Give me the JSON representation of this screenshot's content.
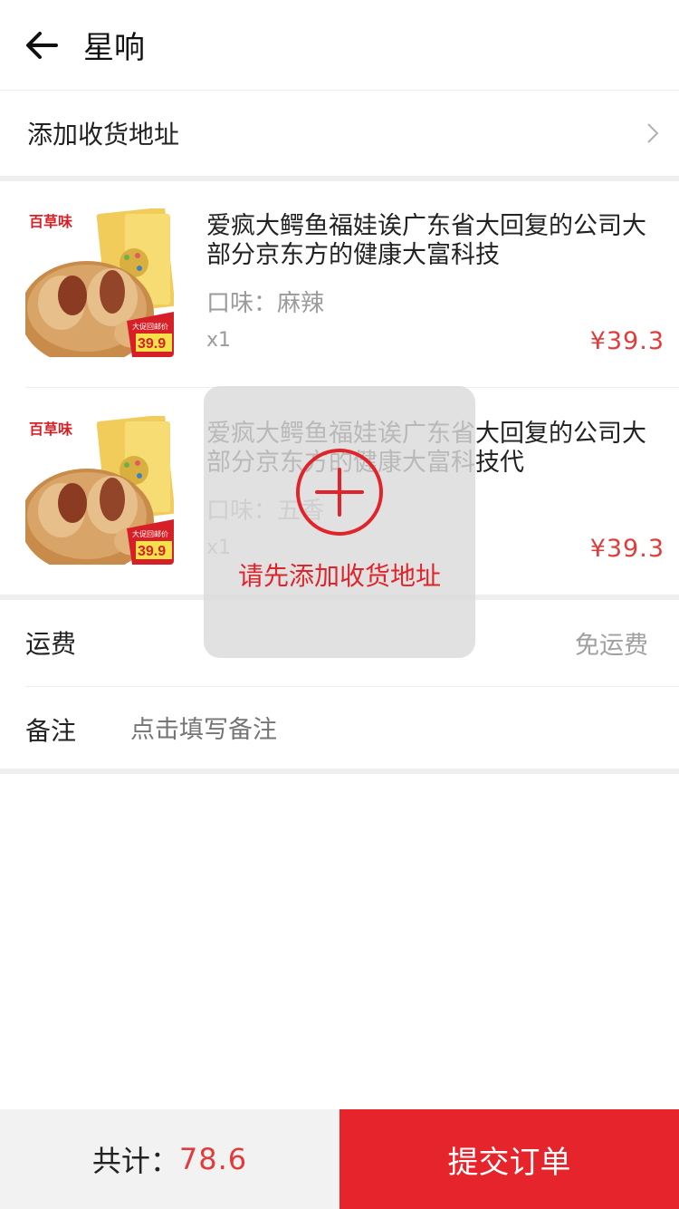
{
  "header": {
    "title": "星响",
    "back_icon": "back-arrow-icon"
  },
  "address": {
    "label": "添加收货地址",
    "chevron_icon": "chevron-right-icon"
  },
  "products": [
    {
      "title": "爱疯大鳄鱼福娃诶广东省大回复的公司大部分京东方的健康大富科技",
      "flavor": "口味：麻辣",
      "quantity": "x1",
      "price": "¥39.3",
      "image_brand": "百草味",
      "image_promo": "大促回邮价",
      "image_price": "39.9"
    },
    {
      "title": "爱疯大鳄鱼福娃诶广东省大回复的公司大部分京东方的健康大富科技代",
      "flavor": "口味：五香",
      "quantity": "x1",
      "price": "¥39.3",
      "image_brand": "百草味",
      "image_promo": "大促回邮价",
      "image_price": "39.9"
    }
  ],
  "shipping": {
    "label": "运费",
    "value": "免运费"
  },
  "remark": {
    "label": "备注",
    "placeholder": "点击填写备注"
  },
  "footer": {
    "total_label": "共计：",
    "total_value": "78.6",
    "submit_label": "提交订单"
  },
  "toast": {
    "icon": "plus-circle-icon",
    "message": "请先添加收货地址"
  },
  "colors": {
    "accent": "#e6242b",
    "price": "#e03c3c",
    "divider": "#eeeeee",
    "footer_bg": "#f2f2f2"
  }
}
